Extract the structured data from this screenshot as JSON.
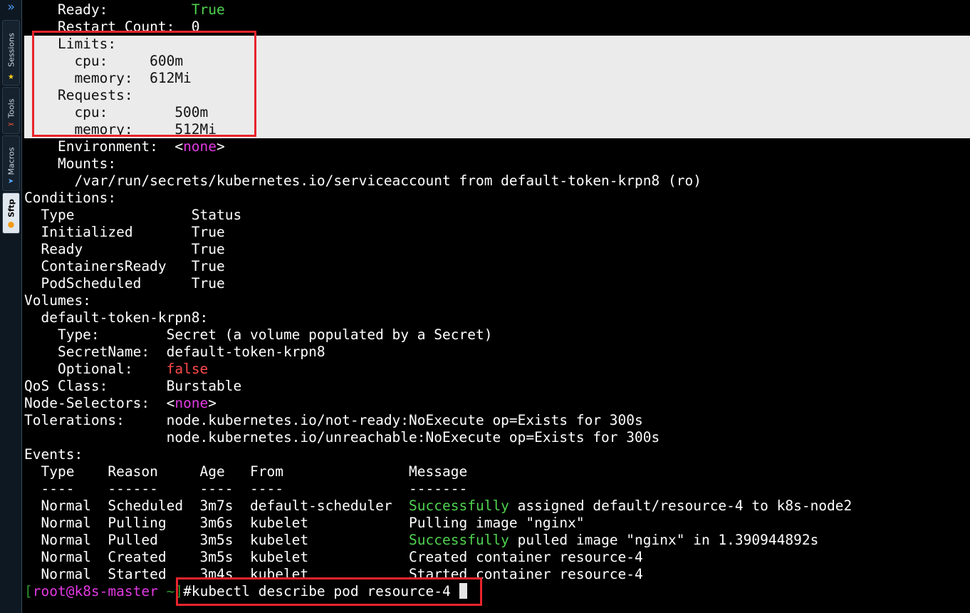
{
  "sidebar": {
    "tabs": [
      {
        "label": "Sessions",
        "icon": "star-icon"
      },
      {
        "label": "Tools",
        "icon": "tools-icon"
      },
      {
        "label": "Macros",
        "icon": "send-icon"
      },
      {
        "label": "Sftp",
        "icon": "sftp-icon"
      }
    ]
  },
  "terminal": {
    "container": {
      "ready_key": "    Ready:          ",
      "ready_val": "True",
      "restart_count": "    Restart Count:  0",
      "limits_header": "    Limits:",
      "limits_cpu": "      cpu:     600m",
      "limits_memory": "      memory:  612Mi",
      "requests_header": "    Requests:",
      "requests_cpu": "      cpu:        500m",
      "requests_memory": "      memory:     512Mi",
      "environment_key": "    Environment:  <",
      "environment_val": "none",
      "environment_close": ">",
      "mounts_header": "    Mounts:",
      "mount_path": "      /var/run/secrets/kubernetes.io/serviceaccount from default-token-krpn8 (ro)"
    },
    "conditions": {
      "header": "Conditions:",
      "rows": [
        "  Type              Status",
        "  Initialized       True",
        "  Ready             True",
        "  ContainersReady   True",
        "  PodScheduled      True"
      ]
    },
    "volumes": {
      "header": "Volumes:",
      "name": "  default-token-krpn8:",
      "type": "    Type:        Secret (a volume populated by a Secret)",
      "secret_name": "    SecretName:  default-token-krpn8",
      "optional_key": "    Optional:    ",
      "optional_val": "false"
    },
    "qos_class": "QoS Class:       Burstable",
    "node_selectors_key": "Node-Selectors:  <",
    "node_selectors_val": "none",
    "node_selectors_close": ">",
    "tolerations_1": "Tolerations:     node.kubernetes.io/not-ready:NoExecute op=Exists for 300s",
    "tolerations_2": "                 node.kubernetes.io/unreachable:NoExecute op=Exists for 300s",
    "events": {
      "header": "Events:",
      "columns": "  Type    Reason     Age   From               Message",
      "separator": "  ----    ------     ----  ----               -------",
      "row1_prefix": "  Normal  Scheduled  3m7s  default-scheduler  ",
      "row1_hl": "Successfully",
      "row1_rest": " assigned default/resource-4 to k8s-node2",
      "row2": "  Normal  Pulling    3m6s  kubelet            Pulling image \"nginx\"",
      "row3_prefix": "  Normal  Pulled     3m5s  kubelet            ",
      "row3_hl": "Successfully",
      "row3_rest": " pulled image \"nginx\" in 1.390944892s",
      "row4": "  Normal  Created    3m5s  kubelet            Created container resource-4",
      "row5": "  Normal  Started    3m4s  kubelet            Started container resource-4"
    },
    "prompt": {
      "open": "[",
      "user_host": "root@k8s-master",
      "cwd": " ~",
      "close": "]",
      "command": "#kubectl describe pod resource-4 "
    }
  },
  "colors": {
    "background": "#000000",
    "text": "#ffffff",
    "green": "#4fd24f",
    "magenta": "#e23ae2",
    "red": "#ff4a4a",
    "highlight_bg": "#ebebeb",
    "annotation_red": "#e8242c"
  }
}
